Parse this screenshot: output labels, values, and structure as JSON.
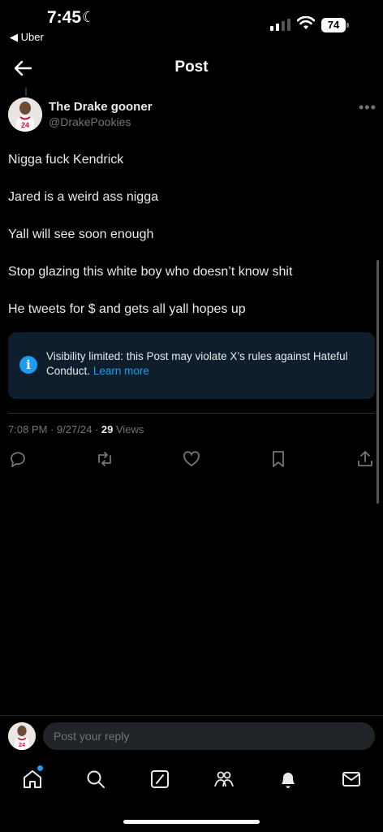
{
  "status_bar": {
    "time": "7:45",
    "back_app": "◀ Uber",
    "battery": "74"
  },
  "header": {
    "title": "Post"
  },
  "post": {
    "author_name": "The Drake gooner",
    "author_handle": "@DrakePookies",
    "avatar_jersey_number": "24",
    "lines": [
      "Nigga fuck Kendrick",
      "Jared is a weird ass nigga",
      "Yall will see soon enough",
      "Stop glazing this white boy who doesn’t know shit",
      "He tweets for $ and gets all yall hopes up"
    ],
    "notice_text": "Visibility limited: this Post may violate X’s rules against Hateful Conduct.",
    "notice_link": "Learn more",
    "timestamp": "7:08 PM · 9/27/24 · ",
    "views_count": "29",
    "views_label": " Views"
  },
  "actions": [
    "reply-icon",
    "repost-icon",
    "like-icon",
    "bookmark-icon",
    "share-icon"
  ],
  "reply": {
    "placeholder": "Post your reply"
  },
  "tabs": [
    "home-icon",
    "search-icon",
    "compose-icon",
    "communities-icon",
    "notifications-icon",
    "messages-icon"
  ],
  "colors": {
    "accent": "#1d9bf0",
    "background": "#000000",
    "notice_bg": "#0f1e2c",
    "secondary_text": "#71767b"
  }
}
